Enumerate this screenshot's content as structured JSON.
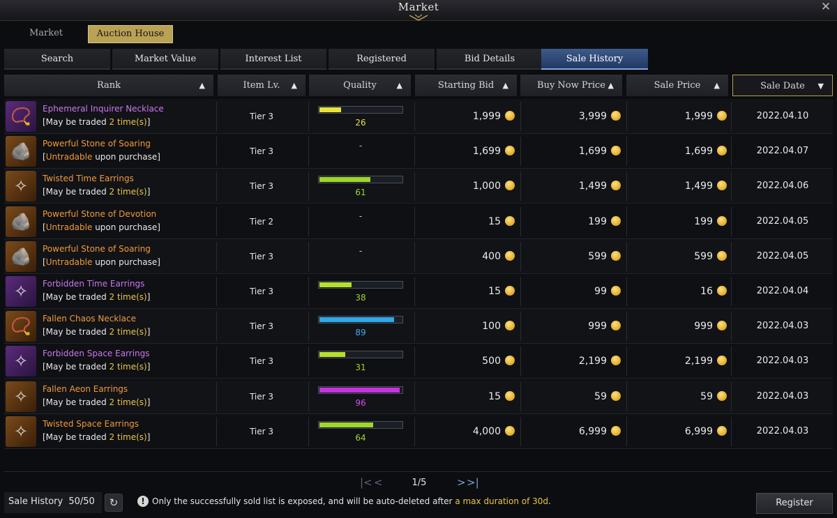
{
  "window": {
    "title": "Market",
    "close_icon": "close-icon"
  },
  "main_tabs": [
    {
      "label": "Market",
      "active": false
    },
    {
      "label": "Auction House",
      "active": true
    }
  ],
  "sub_tabs": [
    {
      "label": "Search",
      "active": false
    },
    {
      "label": "Market Value",
      "active": false
    },
    {
      "label": "Interest List",
      "active": false
    },
    {
      "label": "Registered",
      "active": false
    },
    {
      "label": "Bid Details",
      "active": false
    },
    {
      "label": "Sale History",
      "active": true
    }
  ],
  "columns": [
    {
      "label": "Rank",
      "sort": "▲"
    },
    {
      "label": "Item Lv.",
      "sort": "▲"
    },
    {
      "label": "Quality",
      "sort": "▲"
    },
    {
      "label": "Starting Bid",
      "sort": "▲"
    },
    {
      "label": "Buy Now Price",
      "sort": "▲"
    },
    {
      "label": "Sale Price",
      "sort": "▲"
    },
    {
      "label": "Sale Date",
      "sort": "▼"
    }
  ],
  "rows": [
    {
      "icon": "necklace-icon",
      "icon_glyph": "📿",
      "rarity": "purple",
      "name": "Ephemeral Inquirer Necklace",
      "sub_pre": "[May be traded ",
      "sub_hl": "2 time(s)",
      "sub_post": "]",
      "tier": "Tier 3",
      "quality": 26,
      "quality_color": "#e8e23a",
      "quality_text_color": "#e8e23a",
      "starting_bid": "1,999",
      "buy_now": "3,999",
      "sale_price": "1,999",
      "date": "2022.04.10"
    },
    {
      "icon": "stone-icon",
      "icon_glyph": "🪨",
      "rarity": "orange",
      "name": "Powerful Stone of Soaring",
      "sub_pre": "[",
      "sub_hl": "Untradable",
      "sub_post": " upon purchase]",
      "tier": "Tier 3",
      "quality": null,
      "quality_dash": "-",
      "starting_bid": "1,699",
      "buy_now": "1,699",
      "sale_price": "1,699",
      "date": "2022.04.07"
    },
    {
      "icon": "earrings-icon",
      "icon_glyph": "✧",
      "rarity": "orange",
      "name": "Twisted Time Earrings",
      "sub_pre": "[May be traded ",
      "sub_hl": "2 time(s)",
      "sub_post": "]",
      "tier": "Tier 3",
      "quality": 61,
      "quality_color": "#9fd62a",
      "quality_text_color": "#9fd62a",
      "starting_bid": "1,000",
      "buy_now": "1,499",
      "sale_price": "1,499",
      "date": "2022.04.06"
    },
    {
      "icon": "stone-icon",
      "icon_glyph": "🪨",
      "rarity": "orange",
      "name": "Powerful Stone of Devotion",
      "sub_pre": "[",
      "sub_hl": "Untradable",
      "sub_post": " upon purchase]",
      "tier": "Tier 2",
      "quality": null,
      "quality_dash": "-",
      "starting_bid": "15",
      "buy_now": "199",
      "sale_price": "199",
      "date": "2022.04.05"
    },
    {
      "icon": "stone-icon",
      "icon_glyph": "🪨",
      "rarity": "orange",
      "name": "Powerful Stone of Soaring",
      "sub_pre": "[",
      "sub_hl": "Untradable",
      "sub_post": " upon purchase]",
      "tier": "Tier 3",
      "quality": null,
      "quality_dash": "-",
      "starting_bid": "400",
      "buy_now": "599",
      "sale_price": "599",
      "date": "2022.04.05"
    },
    {
      "icon": "earrings-icon",
      "icon_glyph": "✧",
      "rarity": "purple",
      "name": "Forbidden Time Earrings",
      "sub_pre": "[May be traded ",
      "sub_hl": "2 time(s)",
      "sub_post": "]",
      "tier": "Tier 3",
      "quality": 38,
      "quality_color": "#b6e02a",
      "quality_text_color": "#9fd62a",
      "starting_bid": "15",
      "buy_now": "99",
      "sale_price": "16",
      "date": "2022.04.04"
    },
    {
      "icon": "necklace-icon",
      "icon_glyph": "📿",
      "rarity": "orange",
      "name": "Fallen Chaos Necklace",
      "sub_pre": "[May be traded ",
      "sub_hl": "2 time(s)",
      "sub_post": "]",
      "tier": "Tier 3",
      "quality": 89,
      "quality_color": "#2fa8e8",
      "quality_text_color": "#3fb0ee",
      "starting_bid": "100",
      "buy_now": "999",
      "sale_price": "999",
      "date": "2022.04.03"
    },
    {
      "icon": "earrings-icon",
      "icon_glyph": "✧",
      "rarity": "purple",
      "name": "Forbidden Space Earrings",
      "sub_pre": "[May be traded ",
      "sub_hl": "2 time(s)",
      "sub_post": "]",
      "tier": "Tier 3",
      "quality": 31,
      "quality_color": "#b6e02a",
      "quality_text_color": "#9fd62a",
      "starting_bid": "500",
      "buy_now": "2,199",
      "sale_price": "2,199",
      "date": "2022.04.03"
    },
    {
      "icon": "earrings-icon",
      "icon_glyph": "✧",
      "rarity": "orange",
      "name": "Fallen Aeon Earrings",
      "sub_pre": "[May be traded ",
      "sub_hl": "2 time(s)",
      "sub_post": "]",
      "tier": "Tier 3",
      "quality": 96,
      "quality_color": "#c832e0",
      "quality_text_color": "#d34ef0",
      "starting_bid": "15",
      "buy_now": "59",
      "sale_price": "59",
      "date": "2022.04.03"
    },
    {
      "icon": "earrings-icon",
      "icon_glyph": "✧",
      "rarity": "orange",
      "name": "Twisted Space Earrings",
      "sub_pre": "[May be traded ",
      "sub_hl": "2 time(s)",
      "sub_post": "]",
      "tier": "Tier 3",
      "quality": 64,
      "quality_color": "#9fd62a",
      "quality_text_color": "#9fd62a",
      "starting_bid": "4,000",
      "buy_now": "6,999",
      "sale_price": "6,999",
      "date": "2022.04.03"
    }
  ],
  "pager": {
    "text": "1/5",
    "first_icon": "first-page-icon",
    "prev_icon": "prev-page-icon",
    "next_icon": "next-page-icon",
    "last_icon": "last-page-icon"
  },
  "footer": {
    "history_label": "Sale History",
    "history_count": "50/50",
    "refresh_icon": "refresh-icon",
    "notice_pre": "Only the successfully sold list is exposed, and will be auto-deleted after ",
    "notice_hl": "a max duration of 30d",
    "notice_post": ".",
    "register_label": "Register"
  }
}
